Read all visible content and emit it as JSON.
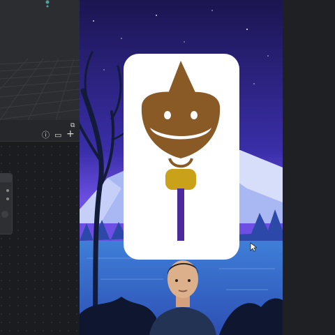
{
  "app": {
    "accent": "#4aa3a0",
    "background": "#1e1f22"
  },
  "toolbar": {
    "icons": [
      "external-link-icon",
      "info-icon",
      "layout-icon",
      "add-icon"
    ],
    "external_glyph": "⧉",
    "info_glyph": "ⓘ",
    "layout_glyph": "▭",
    "add_glyph": "+"
  },
  "video": {
    "scene": "mountain-lake-night",
    "sky_colors": [
      "#1b1550",
      "#3a2ea8",
      "#6d4fe3"
    ],
    "sticker": {
      "face_color": "#8a5a26",
      "stick_color": "#4a2a9e",
      "knot_color": "#c9a21a"
    }
  }
}
